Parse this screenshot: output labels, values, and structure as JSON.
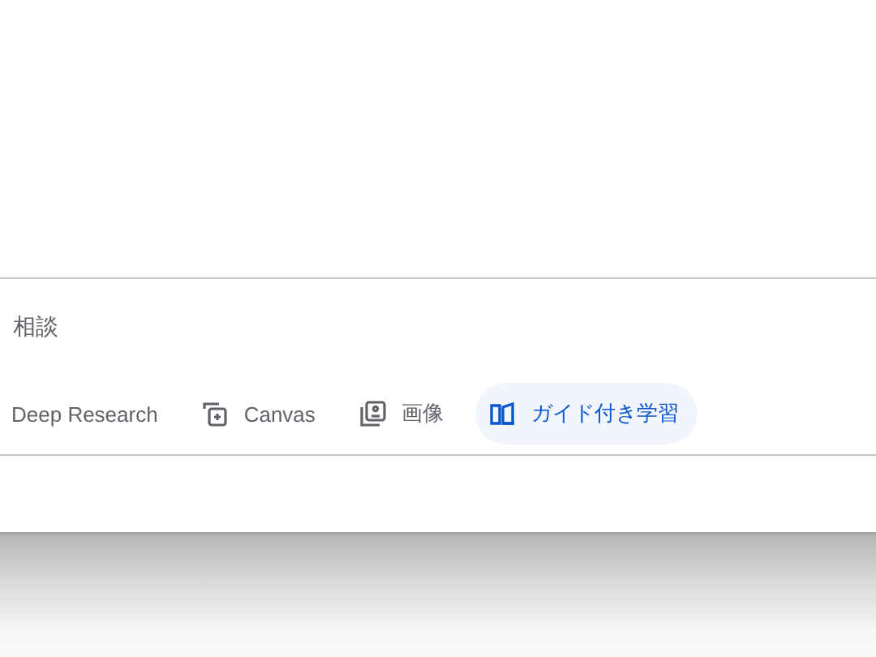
{
  "prompt": {
    "placeholder": "相談"
  },
  "tools": [
    {
      "label": "Deep Research",
      "kind": "plain",
      "selected": false
    },
    {
      "label": "Canvas",
      "kind": "canvas",
      "selected": false
    },
    {
      "label": "画像",
      "kind": "image",
      "selected": false
    },
    {
      "label": "ガイド付き学習",
      "kind": "book",
      "selected": true
    }
  ]
}
